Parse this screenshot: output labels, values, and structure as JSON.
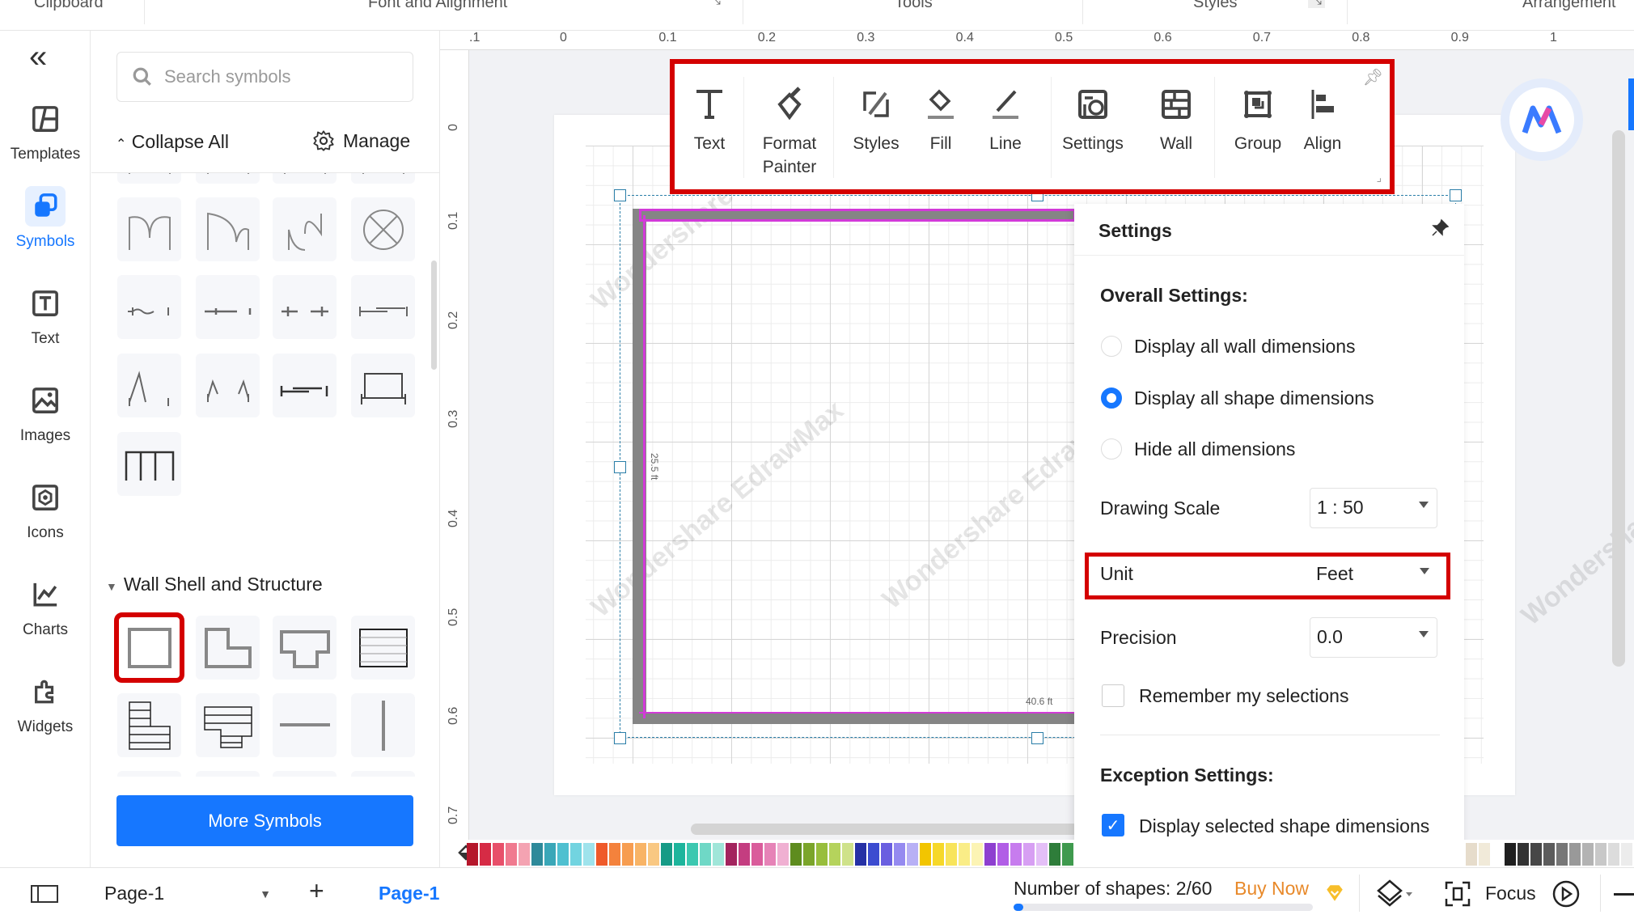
{
  "ribbon": {
    "groups": [
      "Clipboard",
      "Font and Alignment",
      "Tools",
      "Styles",
      "Arrangement"
    ]
  },
  "rail": {
    "items": [
      {
        "label": "Templates",
        "icon": "templates-icon"
      },
      {
        "label": "Symbols",
        "icon": "symbols-icon",
        "active": true
      },
      {
        "label": "Text",
        "icon": "text-icon"
      },
      {
        "label": "Images",
        "icon": "images-icon"
      },
      {
        "label": "Icons",
        "icon": "icons-icon"
      },
      {
        "label": "Charts",
        "icon": "charts-icon"
      },
      {
        "label": "Widgets",
        "icon": "widgets-icon"
      }
    ]
  },
  "panel": {
    "search_placeholder": "Search symbols",
    "collapse_all": "Collapse All",
    "manage": "Manage",
    "section_wall": "Wall Shell and Structure",
    "more_symbols": "More Symbols"
  },
  "ruler": {
    "top": [
      ".1",
      "0",
      "0.1",
      "0.2",
      "0.3",
      "0.4",
      "0.5",
      "0.6",
      "0.7",
      "0.8",
      "0.9",
      "1"
    ],
    "left": [
      "0",
      "0.1",
      "0.2",
      "0.3",
      "0.4",
      "0.5",
      "0.6",
      "0.7"
    ]
  },
  "canvas": {
    "dim_left": "25.5 ft",
    "dim_bottom": "40.6 ft",
    "watermark": "Wondershare EdrawMax",
    "wall_color": "#858585",
    "selection_color": "#d23ad8"
  },
  "toolbar": {
    "items": [
      {
        "label": "Text",
        "icon": "text-icon"
      },
      {
        "label": "Format Painter",
        "icon": "format-painter-icon"
      },
      {
        "label": "Styles",
        "icon": "styles-icon"
      },
      {
        "label": "Fill",
        "icon": "fill-icon"
      },
      {
        "label": "Line",
        "icon": "line-icon"
      },
      {
        "label": "Settings",
        "icon": "settings-icon",
        "active": true
      },
      {
        "label": "Wall",
        "icon": "wall-icon"
      },
      {
        "label": "Group",
        "icon": "group-icon"
      },
      {
        "label": "Align",
        "icon": "align-icon"
      }
    ],
    "highlight_color": "#d40000"
  },
  "settings": {
    "title": "Settings",
    "overall": "Overall Settings:",
    "options": [
      {
        "label": "Display all wall dimensions",
        "selected": false
      },
      {
        "label": "Display all shape dimensions",
        "selected": true
      },
      {
        "label": "Hide all dimensions",
        "selected": false
      }
    ],
    "drawing_scale_label": "Drawing Scale",
    "drawing_scale": "1 : 50",
    "unit_label": "Unit",
    "unit": "Feet",
    "precision_label": "Precision",
    "precision": "0.0",
    "remember": "Remember my selections",
    "remember_checked": false,
    "exception": "Exception Settings:",
    "display_selected": "Display selected shape dimensions",
    "display_selected_checked": true
  },
  "palette": {
    "left": [
      "#b5172b",
      "#d62b45",
      "#e8506a",
      "#f07a8f",
      "#f4a3b2",
      "#2e8a9a",
      "#3aa7b8",
      "#4fc0d0",
      "#72d4e0",
      "#9fe3ec",
      "#ef5a2a",
      "#f4823c",
      "#f79d50",
      "#f8b466",
      "#f9c882",
      "#169b86",
      "#1db59c",
      "#3cc8b0",
      "#6fd8c6",
      "#a0e6d9",
      "#a3245e",
      "#c43d80",
      "#da5c9b",
      "#e683b7",
      "#f0b0d2",
      "#5e8c1e",
      "#7ba52a",
      "#98be3c",
      "#b5d35c",
      "#cfe28a",
      "#2631a5",
      "#3c4cd0",
      "#6a5fe0",
      "#958af0",
      "#b8b0f5",
      "#f2c500",
      "#f6d829",
      "#f8e45a",
      "#faed87",
      "#fcf4b4",
      "#8e3fd0",
      "#b15de6",
      "#c77cee",
      "#d79ff3",
      "#e4bff7",
      "#2e7d3a",
      "#3f9a4e"
    ],
    "right": [
      "#e6dccb",
      "#f1ead9",
      "#ffffff",
      "#1f1f1f",
      "#333333",
      "#474747",
      "#5c5c5c",
      "#777777",
      "#999999",
      "#b3b3b3",
      "#c8c8c8",
      "#dcdcdc",
      "#ececec"
    ]
  },
  "bottom": {
    "page_select": "Page-1",
    "page_tab": "Page-1",
    "shapes": "Number of shapes: 2/60",
    "shapes_progress": 0.033,
    "buy_now": "Buy Now",
    "focus": "Focus"
  }
}
